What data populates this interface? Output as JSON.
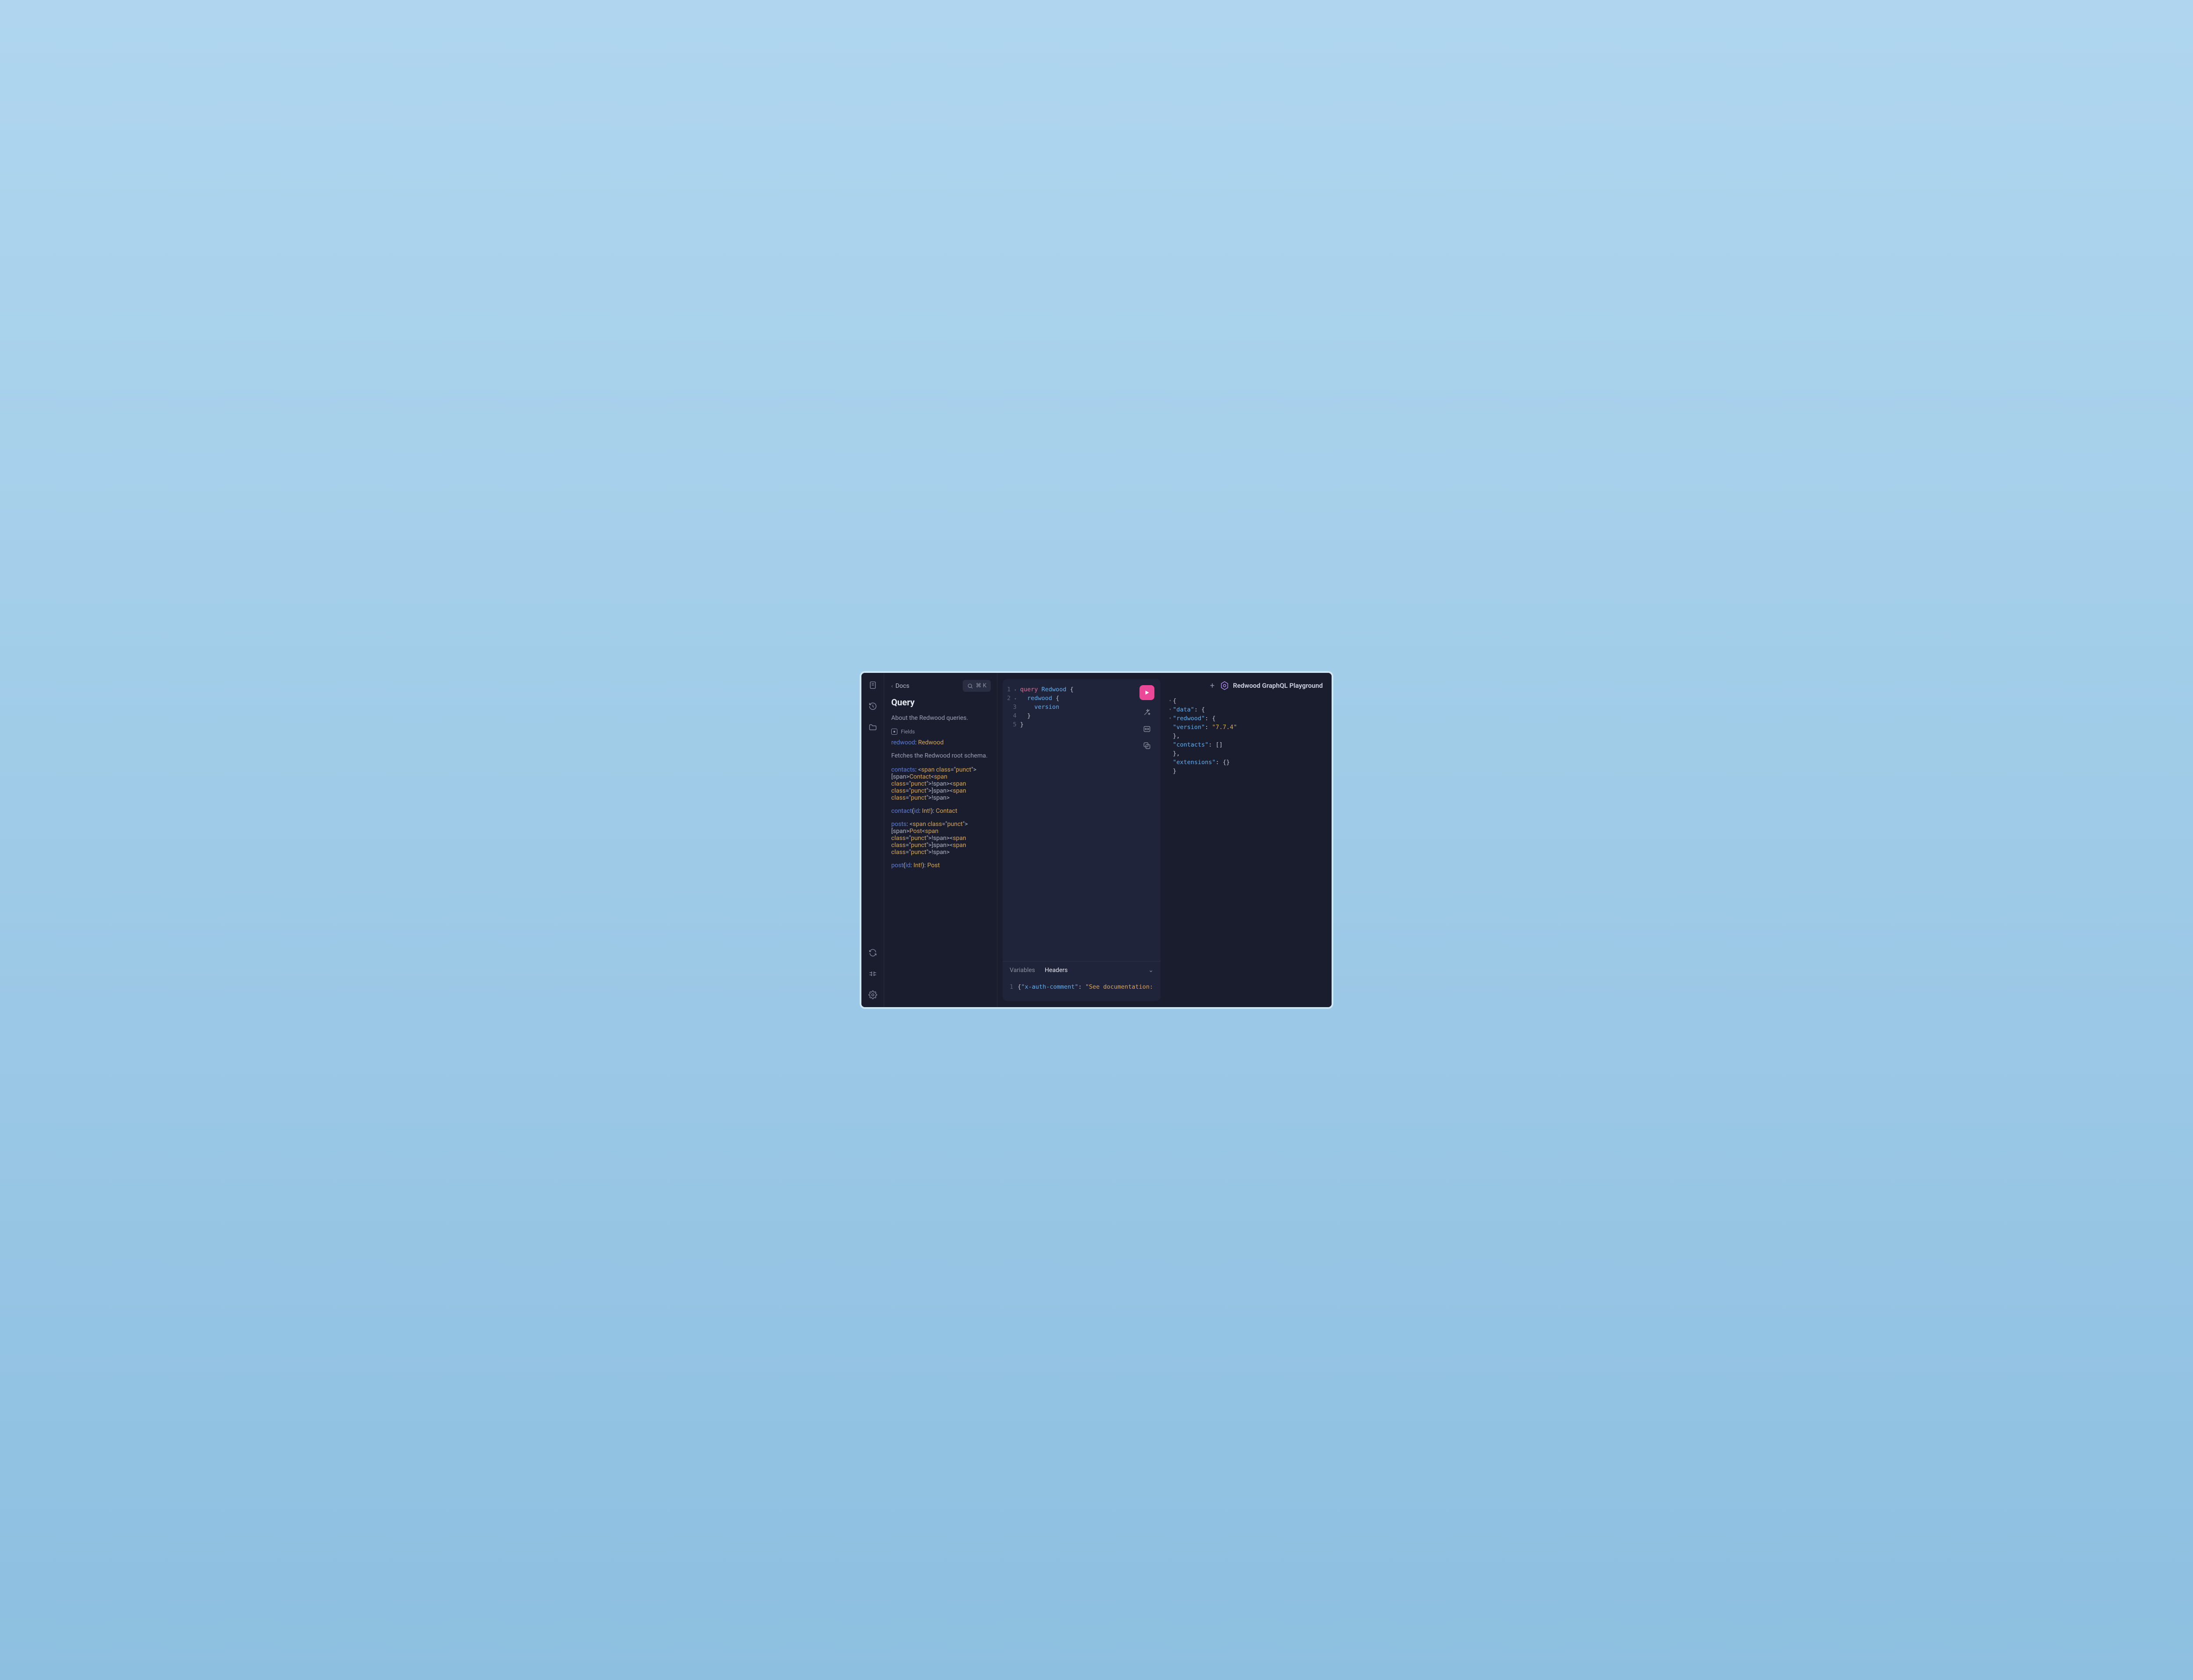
{
  "sidebar": {
    "icons": [
      "docs-icon",
      "history-icon",
      "folder-icon",
      "refresh-icon",
      "keyboard-icon",
      "settings-icon"
    ]
  },
  "docs": {
    "back_label": "Docs",
    "search_shortcut": "⌘ K",
    "title": "Query",
    "description": "About the Redwood queries.",
    "fields_label": "Fields",
    "fields": [
      {
        "name": "redwood",
        "args": "",
        "type": "Redwood",
        "desc": "Fetches the Redwood root schema."
      },
      {
        "name": "contacts",
        "args": "",
        "type": "[Contact!]!"
      },
      {
        "name": "contact",
        "args": "(id: Int!)",
        "type": "Contact"
      },
      {
        "name": "posts",
        "args": "",
        "type": "[Post!]!"
      },
      {
        "name": "post",
        "args": "(id: Int!)",
        "type": "Post"
      }
    ]
  },
  "editor": {
    "lines": [
      {
        "n": "1",
        "fold": true,
        "tokens": [
          [
            "kw",
            "query"
          ],
          [
            "sp",
            " "
          ],
          [
            "opname",
            "Redwood"
          ],
          [
            "sp",
            " "
          ],
          [
            "brace",
            "{"
          ]
        ]
      },
      {
        "n": "2",
        "fold": true,
        "tokens": [
          [
            "sp",
            "  "
          ],
          [
            "fld",
            "redwood"
          ],
          [
            "sp",
            " "
          ],
          [
            "brace",
            "{"
          ]
        ]
      },
      {
        "n": "3",
        "fold": false,
        "tokens": [
          [
            "sp",
            "    "
          ],
          [
            "fld",
            "version"
          ]
        ]
      },
      {
        "n": "4",
        "fold": false,
        "tokens": [
          [
            "sp",
            "  "
          ],
          [
            "brace",
            "}"
          ]
        ]
      },
      {
        "n": "5",
        "fold": false,
        "tokens": [
          [
            "brace",
            "}"
          ]
        ]
      }
    ],
    "tabs": {
      "variables": "Variables",
      "headers": "Headers",
      "active": "headers"
    },
    "headers_line_no": "1",
    "headers_json": {
      "key": "\"x-auth-comment\"",
      "sep": ": ",
      "val": "\"See documentation:"
    }
  },
  "response": {
    "new_tab": "+",
    "title": "Redwood GraphQL Playground",
    "json_lines": [
      {
        "fold": true,
        "indent": 0,
        "text": [
          [
            "jpunct",
            "{"
          ]
        ]
      },
      {
        "fold": true,
        "indent": 1,
        "text": [
          [
            "jkey",
            "\"data\""
          ],
          [
            "jpunct",
            ": {"
          ]
        ]
      },
      {
        "fold": true,
        "indent": 2,
        "text": [
          [
            "jkey",
            "\"redwood\""
          ],
          [
            "jpunct",
            ": {"
          ]
        ]
      },
      {
        "fold": false,
        "indent": 3,
        "text": [
          [
            "jkey",
            "\"version\""
          ],
          [
            "jpunct",
            ": "
          ],
          [
            "jstr",
            "\"7.7.4\""
          ]
        ]
      },
      {
        "fold": false,
        "indent": 2,
        "text": [
          [
            "jpunct",
            "},"
          ]
        ]
      },
      {
        "fold": false,
        "indent": 2,
        "text": [
          [
            "jkey",
            "\"contacts\""
          ],
          [
            "jpunct",
            ": []"
          ]
        ]
      },
      {
        "fold": false,
        "indent": 1,
        "text": [
          [
            "jpunct",
            "},"
          ]
        ]
      },
      {
        "fold": false,
        "indent": 1,
        "text": [
          [
            "jkey",
            "\"extensions\""
          ],
          [
            "jpunct",
            ": {}"
          ]
        ]
      },
      {
        "fold": false,
        "indent": 0,
        "text": [
          [
            "jpunct",
            "}"
          ]
        ]
      }
    ]
  }
}
